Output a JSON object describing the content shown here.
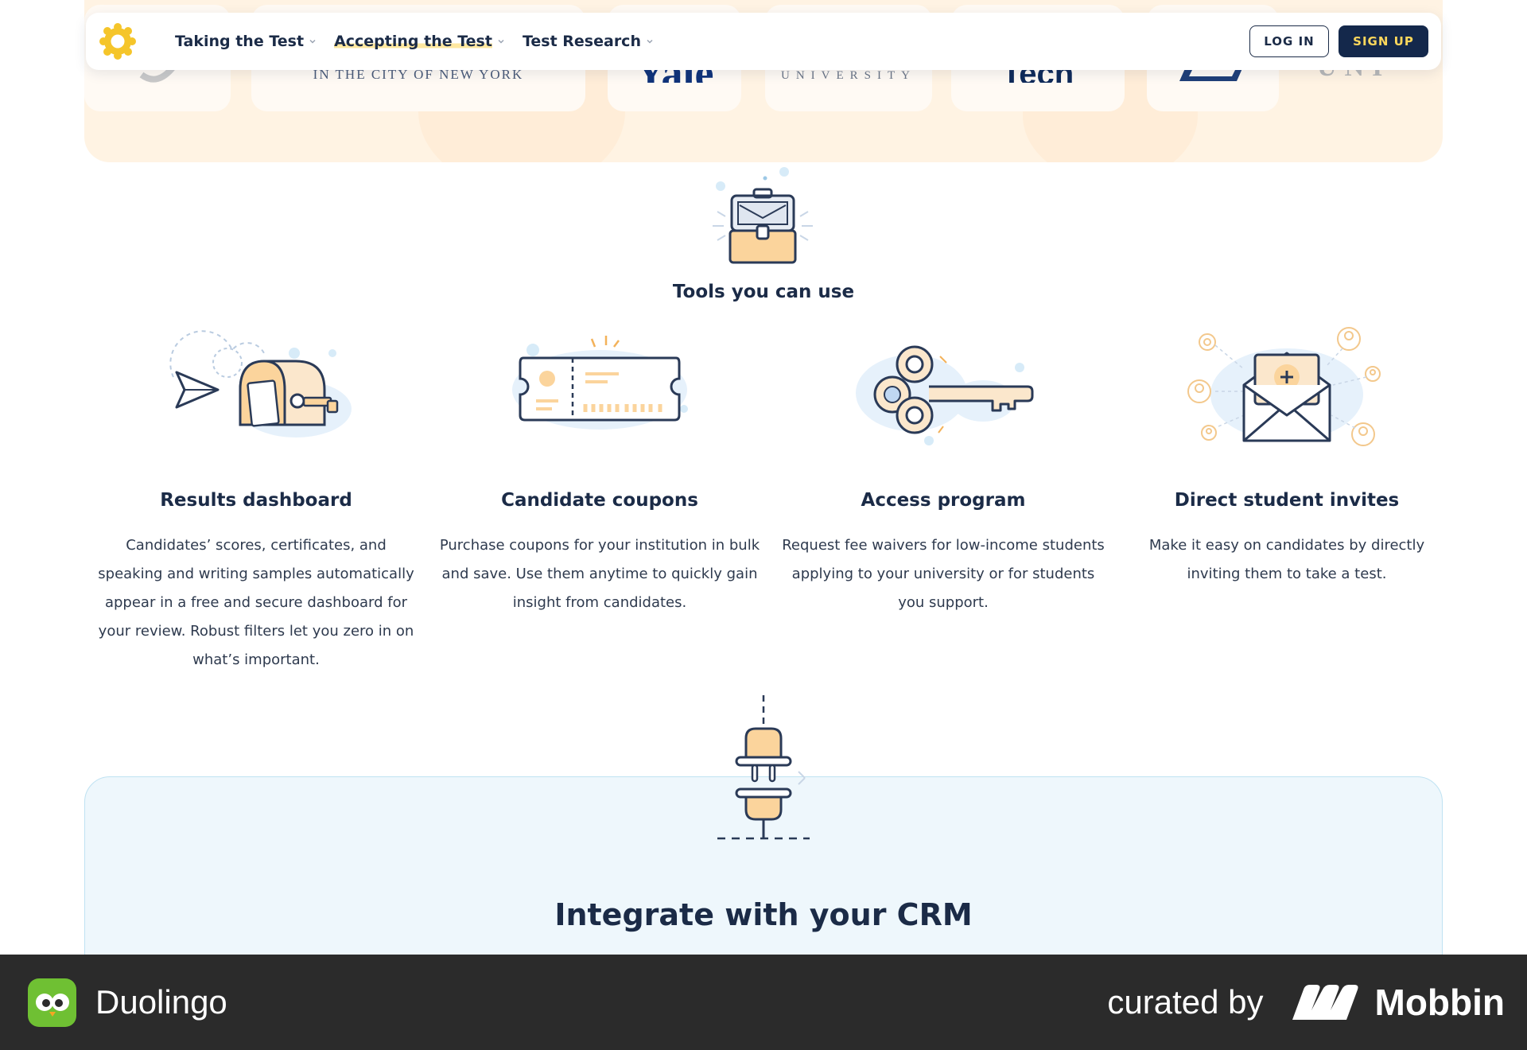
{
  "nav": {
    "items": [
      {
        "label": "Taking the Test",
        "active": false
      },
      {
        "label": "Accepting the Test",
        "active": true
      },
      {
        "label": "Test Research",
        "active": false
      }
    ],
    "login_label": "LOG IN",
    "signup_label": "SIGN UP"
  },
  "logo_strip": {
    "visible_texts": [
      "IN THE CITY OF NEW YORK",
      "Yale",
      "UNIVERSITY",
      "Tech",
      "UNI"
    ]
  },
  "tools": {
    "title": "Tools you can use",
    "items": [
      {
        "title": "Results dashboard",
        "description": "Candidates’ scores, certificates, and speaking and writing samples automatically appear in a free and secure dashboard for your review. Robust filters let you zero in on what’s important.",
        "icon": "mailbox-icon"
      },
      {
        "title": "Candidate coupons",
        "description": "Purchase coupons for your institution in bulk and save. Use them anytime to quickly gain insight from candidates.",
        "icon": "ticket-icon"
      },
      {
        "title": "Access program",
        "description": "Request fee waivers for low-income students applying to your university or for students you support.",
        "icon": "key-icon"
      },
      {
        "title": "Direct student invites",
        "description": "Make it easy on candidates by directly inviting them to take a test.",
        "icon": "envelope-icon"
      }
    ]
  },
  "crm": {
    "title": "Integrate with your CRM"
  },
  "footer": {
    "app_name": "Duolingo",
    "curated_by": "curated by",
    "brand": "Mobbin"
  },
  "colors": {
    "navy": "#14284b",
    "text": "#1b2b47",
    "accent_yellow": "#ffd85c",
    "peach": "#fff3e3",
    "crm_bg": "#eef7fc",
    "footer_bg": "#2b2b2b"
  }
}
